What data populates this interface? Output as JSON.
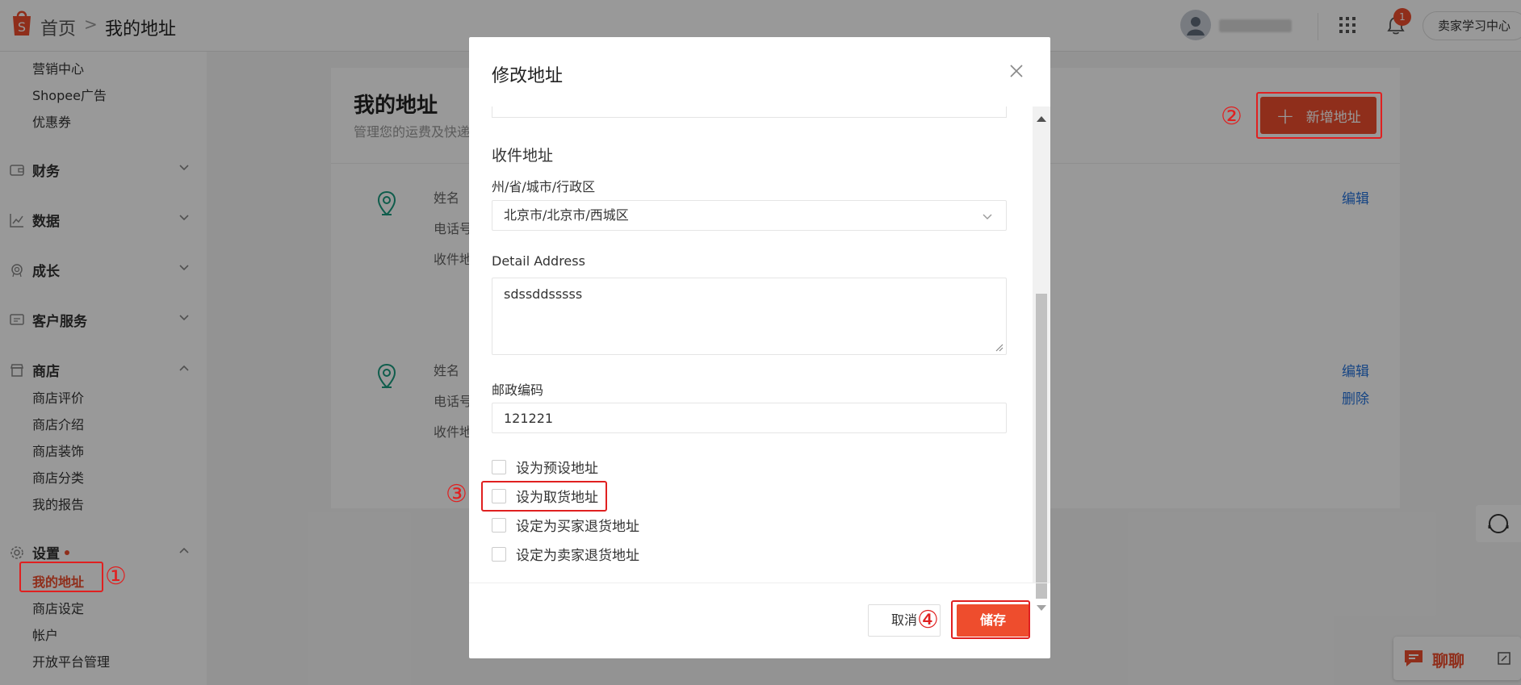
{
  "header": {
    "breadcrumb_home": "首页",
    "breadcrumb_separator": ">",
    "breadcrumb_current": "我的地址",
    "notification_count": "1",
    "seller_center": "卖家学习中心"
  },
  "sidebar": {
    "marketing_items": [
      "营销中心",
      "Shopee广告",
      "优惠券"
    ],
    "groups": {
      "finance": "财务",
      "data": "数据",
      "growth": "成长",
      "customer_service": "客户服务",
      "shop": "商店",
      "settings": "设置"
    },
    "shop_items": [
      "商店评价",
      "商店介绍",
      "商店装饰",
      "商店分类",
      "我的报告"
    ],
    "settings_items": [
      "我的地址",
      "商店设定",
      "帐户",
      "开放平台管理"
    ]
  },
  "main": {
    "title": "我的地址",
    "subtitle": "管理您的运费及快递",
    "add_button": "新增地址",
    "address_labels": [
      "姓名",
      "电话号",
      "收件地"
    ],
    "edit_label": "编辑",
    "delete_label": "删除"
  },
  "modal": {
    "title": "修改地址",
    "section_title": "收件地址",
    "region_label": "州/省/城市/行政区",
    "region_value": "北京市/北京市/西城区",
    "detail_label": "Detail Address",
    "detail_value": "sdssddsssss",
    "postal_label": "邮政编码",
    "postal_value": "121221",
    "checkboxes": [
      "设为预设地址",
      "设为取货地址",
      "设定为买家退货地址",
      "设定为卖家退货地址"
    ],
    "cancel": "取消",
    "save": "储存"
  },
  "annotations": [
    "①",
    "②",
    "③",
    "④"
  ],
  "chat": {
    "label": "聊聊"
  },
  "colors": {
    "brand": "#ee4d2d",
    "annotation": "#e02020",
    "link": "#2673dd"
  }
}
